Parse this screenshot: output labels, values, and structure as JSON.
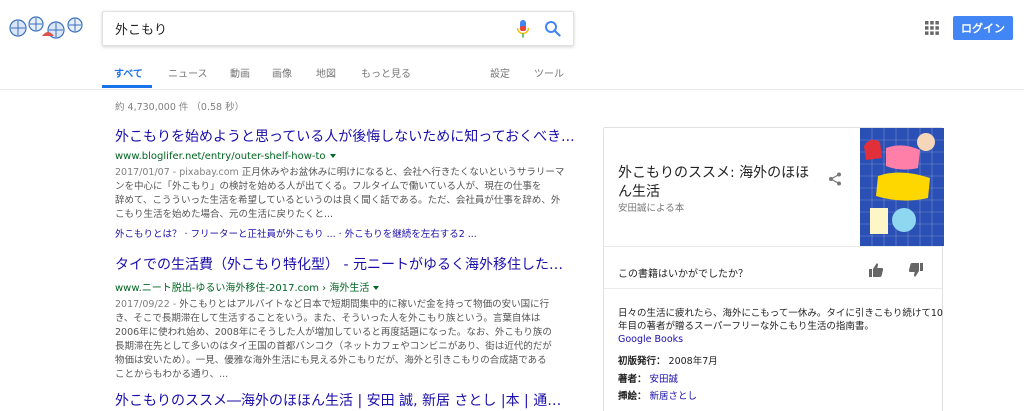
{
  "search": {
    "query": "外こもり"
  },
  "header": {
    "login_label": "ログイン"
  },
  "tabs": [
    {
      "label": "すべて"
    },
    {
      "label": "ニュース"
    },
    {
      "label": "動画"
    },
    {
      "label": "画像"
    },
    {
      "label": "地図"
    },
    {
      "label": "もっと見る"
    },
    {
      "label": "設定"
    },
    {
      "label": "ツール"
    }
  ],
  "stats": "約 4,730,000 件 （0.58 秒）",
  "results": [
    {
      "title": "外こもりを始めようと思っている人が後悔しないために知っておくべき...",
      "url": "www.bloglifer.net/entry/outer-shelf-how-to",
      "date": "2017/01/07 - pixabay.com",
      "snippet_lines": [
        "正月休みやお盆休みに明けになると、会社へ行きたくないというサラリーマ",
        "ンを中心に「外こもり」の検討を始める人が出てくる。フルタイムで働いている人が、現在の仕事を",
        "辞めて、こうういった生活を希望しているというのは良く聞く話である。ただ、会社員が仕事を辞め、外",
        "こもり生活を始めた場合、元の生活に戻りたくと..."
      ],
      "sitelinks": "外こもりとは？ · フリーターと正社員が外こもり ... · 外こもりを継続を左右する2 ..."
    },
    {
      "title": "タイでの生活費（外こもり特化型） - 元ニートがゆるく海外移住した結果",
      "url": "www.ニート脱出-ゆるい海外移住-2017.com › 海外生活",
      "date": "2017/09/22 -",
      "snippet_lines": [
        "外こもりとはアルバイトなど日本で短期間集中的に稼いだ金を持って物価の安い国に行",
        "き、そこで長期滞在して生活することをいう。また、そういった人を外こもり族という。言葉自体は",
        "2006年に使われ始め、2008年にそうした人が増加していると再度話題になった。なお、外こもり族の",
        "長期滞在先として多いのはタイ王国の首都バンコク（ネットカフェやコンビニがあり、街は近代的だが",
        "物価は安いため）。一見、優雅な海外生活にも見える外こもりだが、海外と引きこもりの合成語である",
        "ことからもわかる通り、..."
      ],
      "sitelinks": ""
    },
    {
      "title": "外こもりのススメ―海外のほほん生活 | 安田 誠, 新居 さとし |本 | 通販 ...",
      "url": "",
      "date": "",
      "snippet_lines": [],
      "sitelinks": ""
    }
  ],
  "knowledge_panel": {
    "title": "外こもりのススメ: 海外のほほん生活",
    "subtitle": "安田誠による本",
    "question": "この書籍はいかがでしたか？",
    "description": "日々の生活に疲れたら、海外にこもって一休み。タイに引きこもり続けて10年目の著者が贈るスーパーフリーな外こもり生活の指南書。",
    "source": "Google Books",
    "facts": [
      {
        "label": "初版発行：",
        "value": "2008年7月",
        "is_link": false
      },
      {
        "label": "著者：",
        "value": "安田誠",
        "is_link": true
      },
      {
        "label": "挿絵：",
        "value": "新居さとし",
        "is_link": true
      }
    ]
  },
  "colors": {
    "accent": "#1a73e8",
    "link": "#1a0dab",
    "url": "#006621",
    "login": "#4285f4"
  }
}
